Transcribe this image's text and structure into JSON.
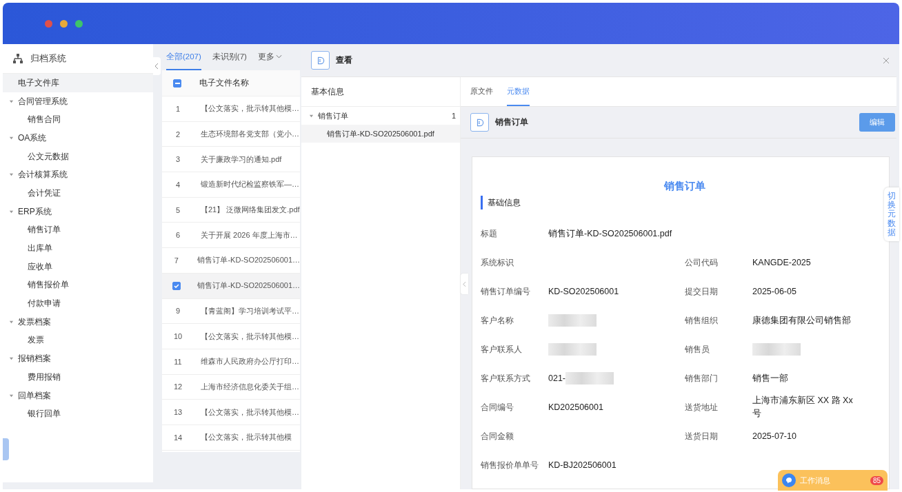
{
  "sidebar": {
    "title": "归档系统",
    "items": [
      {
        "label": "电子文件库",
        "selected": true,
        "expanded": false
      },
      {
        "label": "合同管理系统",
        "selected": false,
        "expanded": true,
        "children": [
          {
            "label": "销售合同",
            "selected": false
          }
        ]
      },
      {
        "label": "OA系统",
        "selected": false,
        "expanded": true,
        "children": [
          {
            "label": "公文元数据",
            "selected": false
          }
        ]
      },
      {
        "label": "会计核算系统",
        "selected": false,
        "expanded": true,
        "children": [
          {
            "label": "会计凭证",
            "selected": false
          }
        ]
      },
      {
        "label": "ERP系统",
        "selected": false,
        "expanded": true,
        "children": [
          {
            "label": "销售订单",
            "selected": false
          },
          {
            "label": "出库单",
            "selected": false
          },
          {
            "label": "应收单",
            "selected": false
          },
          {
            "label": "销售报价单",
            "selected": false
          },
          {
            "label": "付款申请",
            "selected": false
          }
        ]
      },
      {
        "label": "发票档案",
        "selected": false,
        "expanded": true,
        "children": [
          {
            "label": "发票",
            "selected": false
          }
        ]
      },
      {
        "label": "报销档案",
        "selected": false,
        "expanded": true,
        "children": [
          {
            "label": "费用报销",
            "selected": false
          }
        ]
      },
      {
        "label": "回单档案",
        "selected": false,
        "expanded": true,
        "children": [
          {
            "label": "银行回单",
            "selected": false
          }
        ]
      }
    ]
  },
  "file_list": {
    "tabs": [
      {
        "label": "全部(207)",
        "selected": true
      },
      {
        "label": "未识别(7)",
        "selected": false
      }
    ],
    "more": "更多",
    "header_indeterminate": true,
    "column": "电子文件名称",
    "rows": [
      {
        "no": "1",
        "name": "【公文落实，批示转其他模…",
        "checked": false
      },
      {
        "no": "2",
        "name": "生态环境部各党支部（党小…",
        "checked": false
      },
      {
        "no": "3",
        "name": "关于廉政学习的通知.pdf",
        "checked": false
      },
      {
        "no": "4",
        "name": "锻造新时代纪检监察铁军—…",
        "checked": false
      },
      {
        "no": "5",
        "name": "【21】 泛微网络集团发文.pdf",
        "checked": false
      },
      {
        "no": "6",
        "name": "关于开展 2026 年度上海市…",
        "checked": false
      },
      {
        "no": "7",
        "name": "销售订单-KD-SO202506001…",
        "checked": false
      },
      {
        "name": "销售订单-KD-SO202506001…",
        "checked": true
      },
      {
        "no": "9",
        "name": "【青蓝阁】学习培训考试平…",
        "checked": false
      },
      {
        "no": "10",
        "name": "【公文落实，批示转其他模…",
        "checked": false
      },
      {
        "no": "11",
        "name": "维森市人民政府办公厅打印…",
        "checked": false
      },
      {
        "no": "12",
        "name": "上海市经济信息化委关于组…",
        "checked": false
      },
      {
        "no": "13",
        "name": "【公文落实，批示转其他模…",
        "checked": false
      },
      {
        "no": "14",
        "name": "【公文落实，批示转其他模",
        "checked": false
      }
    ]
  },
  "viewer": {
    "title": "查看",
    "info_title": "基本信息",
    "tree": [
      {
        "label": "销售订单",
        "count": "1",
        "expanded": true,
        "children": [
          {
            "label": "销售订单-KD-SO202506001.pdf",
            "selected": true
          }
        ]
      }
    ],
    "tabs": [
      {
        "label": "原文件",
        "selected": false
      },
      {
        "label": "元数据",
        "selected": true
      }
    ],
    "section_title": "销售订单",
    "edit_button": "编辑",
    "form": {
      "title": "销售订单",
      "group": "基础信息",
      "rows": [
        [
          {
            "label": "标题",
            "value": "销售订单-KD-SO202506001.pdf",
            "redacted": false
          }
        ],
        [
          {
            "label": "系统标识",
            "redacted": false
          },
          {
            "label": "公司代码",
            "value": "KANGDE-2025",
            "redacted": false
          }
        ],
        [
          {
            "label": "销售订单编号",
            "value": "KD-SO202506001",
            "redacted": false
          },
          {
            "label": "提交日期",
            "value": "2025-06-05",
            "redacted": false
          }
        ],
        [
          {
            "label": "客户名称",
            "redacted": true
          },
          {
            "label": "销售组织",
            "value": "康德集团有限公司销售部",
            "redacted": false
          }
        ],
        [
          {
            "label": "客户联系人",
            "redacted": true
          },
          {
            "label": "销售员",
            "redacted": true
          }
        ],
        [
          {
            "label": "客户联系方式",
            "value": "021-",
            "redacted": true
          },
          {
            "label": "销售部门",
            "value": "销售一部",
            "redacted": false
          }
        ],
        [
          {
            "label": "合同编号",
            "value": "KD202506001",
            "redacted": false
          },
          {
            "label": "送货地址",
            "value": "上海市浦东新区 XX 路 Xx 号",
            "redacted": false
          }
        ],
        [
          {
            "label": "合同金额",
            "redacted": false
          },
          {
            "label": "送货日期",
            "value": "2025-07-10",
            "redacted": false
          }
        ],
        [
          {
            "label": "销售报价单单号",
            "value": "KD-BJ202506001",
            "redacted": false
          }
        ]
      ]
    },
    "switch_tab": "切换元数据"
  },
  "chat": {
    "label": "工作消息",
    "badge": "85"
  }
}
